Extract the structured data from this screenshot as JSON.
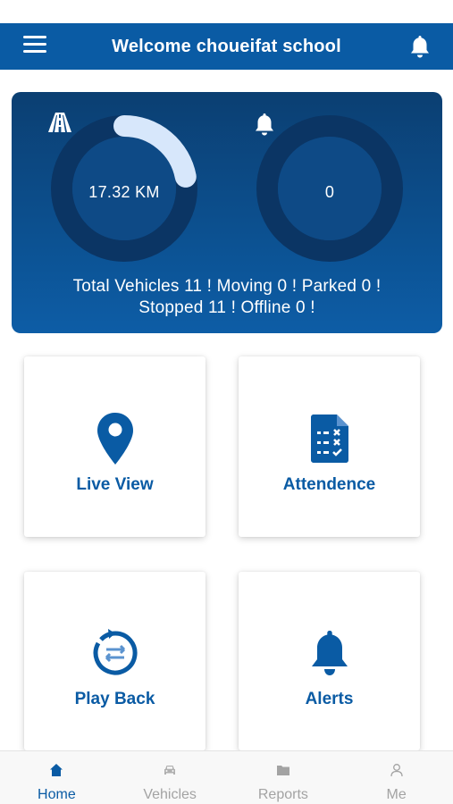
{
  "header": {
    "title": "Welcome choueifat school"
  },
  "summary": {
    "distance": "17.32 KM",
    "distance_fraction": 0.22,
    "alerts": "0",
    "stats_line1": "Total Vehicles 11 ! Moving 0 ! Parked 0 !",
    "stats_line2": "Stopped 11 ! Offline 0 !"
  },
  "cards": [
    {
      "label": "Live View",
      "icon": "location-pin-icon"
    },
    {
      "label": "Attendence",
      "icon": "attendance-sheet-icon"
    },
    {
      "label": "Play Back",
      "icon": "playback-icon"
    },
    {
      "label": "Alerts",
      "icon": "bell-icon"
    }
  ],
  "tabs": [
    {
      "label": "Home",
      "icon": "home-icon",
      "active": true
    },
    {
      "label": "Vehicles",
      "icon": "car-icon",
      "active": false
    },
    {
      "label": "Reports",
      "icon": "folder-icon",
      "active": false
    },
    {
      "label": "Me",
      "icon": "user-icon",
      "active": false
    }
  ],
  "colors": {
    "primary": "#0a5ba4",
    "panel_top": "#0b3f72",
    "inactive": "#a3a3a3"
  }
}
